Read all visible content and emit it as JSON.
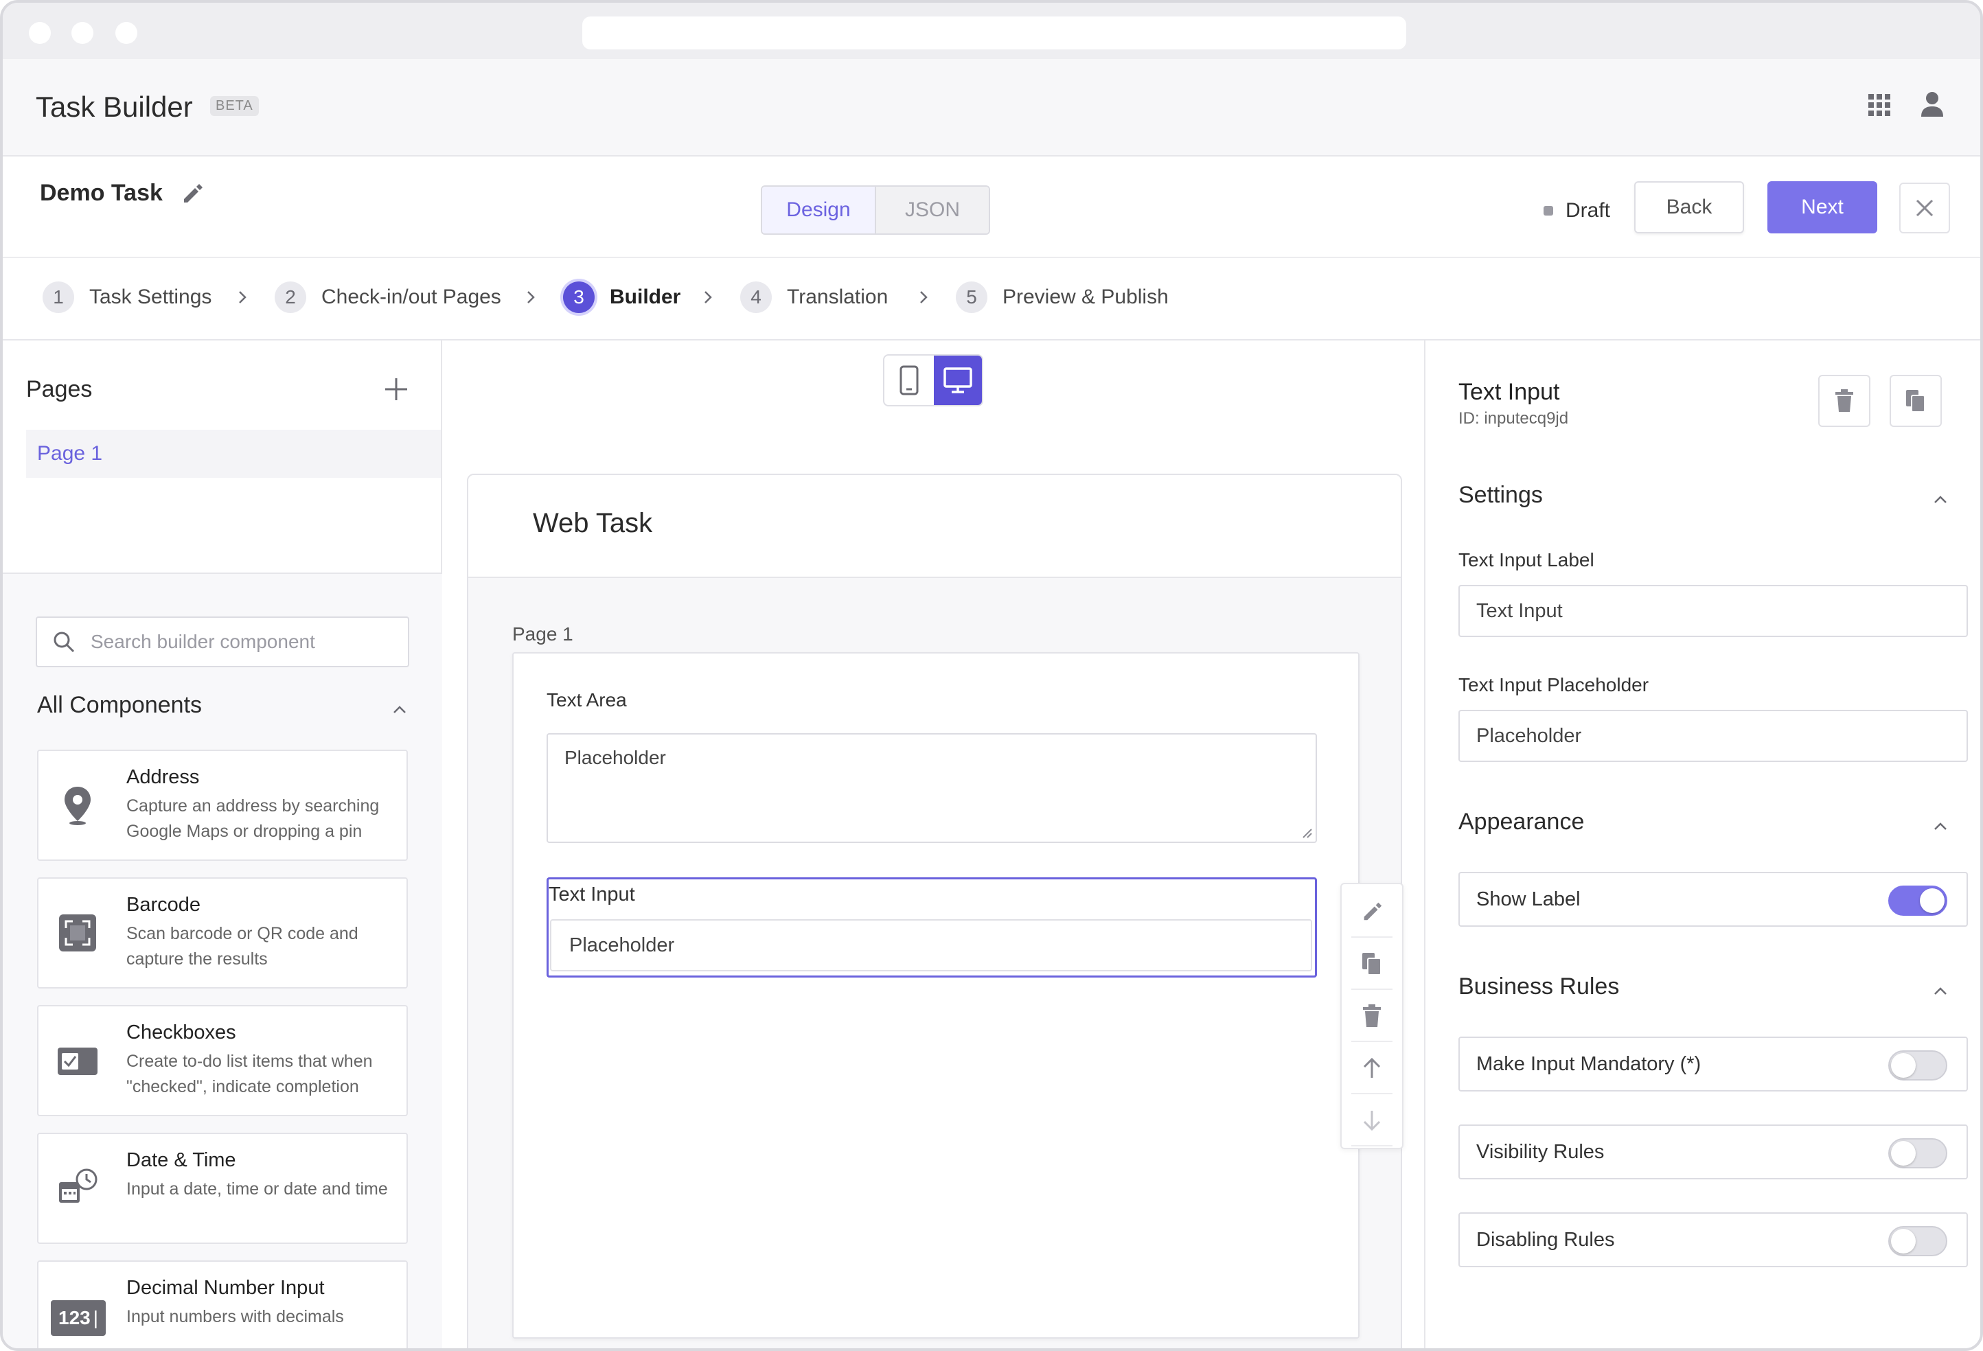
{
  "app": {
    "title": "Task Builder",
    "badge": "BETA"
  },
  "task": {
    "name": "Demo Task",
    "status": "Draft"
  },
  "view_tabs": {
    "design": "Design",
    "json": "JSON",
    "active": "Design"
  },
  "actions": {
    "back": "Back",
    "next": "Next"
  },
  "steps": [
    {
      "num": "1",
      "label": "Task Settings"
    },
    {
      "num": "2",
      "label": "Check-in/out Pages"
    },
    {
      "num": "3",
      "label": "Builder",
      "active": true
    },
    {
      "num": "4",
      "label": "Translation"
    },
    {
      "num": "5",
      "label": "Preview & Publish"
    }
  ],
  "pages_panel": {
    "title": "Pages",
    "items": [
      "Page 1"
    ]
  },
  "components_panel": {
    "search_placeholder": "Search builder component",
    "section_title": "All Components",
    "items": [
      {
        "name": "Address",
        "description": "Capture an address by searching Google Maps or dropping a pin",
        "icon": "map-pin-icon"
      },
      {
        "name": "Barcode",
        "description": "Scan barcode or QR code and capture the results",
        "icon": "barcode-scan-icon"
      },
      {
        "name": "Checkboxes",
        "description": "Create to-do list items that when \"checked\", indicate completion",
        "icon": "checkbox-icon"
      },
      {
        "name": "Date & Time",
        "description": "Input a date, time or date and time",
        "icon": "calendar-clock-icon"
      },
      {
        "name": "Decimal Number Input",
        "description": "Input numbers with decimals",
        "icon": "number-123-icon",
        "icon_text": "123"
      }
    ]
  },
  "canvas": {
    "device": "desktop",
    "card_title": "Web Task",
    "page_label": "Page 1",
    "text_area": {
      "label": "Text Area",
      "placeholder": "Placeholder"
    },
    "text_input": {
      "label": "Text Input",
      "placeholder": "Placeholder"
    }
  },
  "properties": {
    "title": "Text Input",
    "id_text": "ID: inputecq9jd",
    "settings": {
      "title": "Settings",
      "label_field": {
        "label": "Text Input Label",
        "value": "Text Input"
      },
      "placeholder_field": {
        "label": "Text Input Placeholder",
        "value": "Placeholder"
      }
    },
    "appearance": {
      "title": "Appearance",
      "show_label": {
        "label": "Show Label",
        "on": true
      }
    },
    "business_rules": {
      "title": "Business Rules",
      "items": [
        {
          "label": "Make Input Mandatory (*)",
          "on": false
        },
        {
          "label": "Visibility Rules",
          "on": false
        },
        {
          "label": "Disabling Rules",
          "on": false
        }
      ]
    }
  },
  "colors": {
    "accent": "#5b50d8",
    "accent_light": "#7b73ea",
    "border": "#dcdce2"
  }
}
